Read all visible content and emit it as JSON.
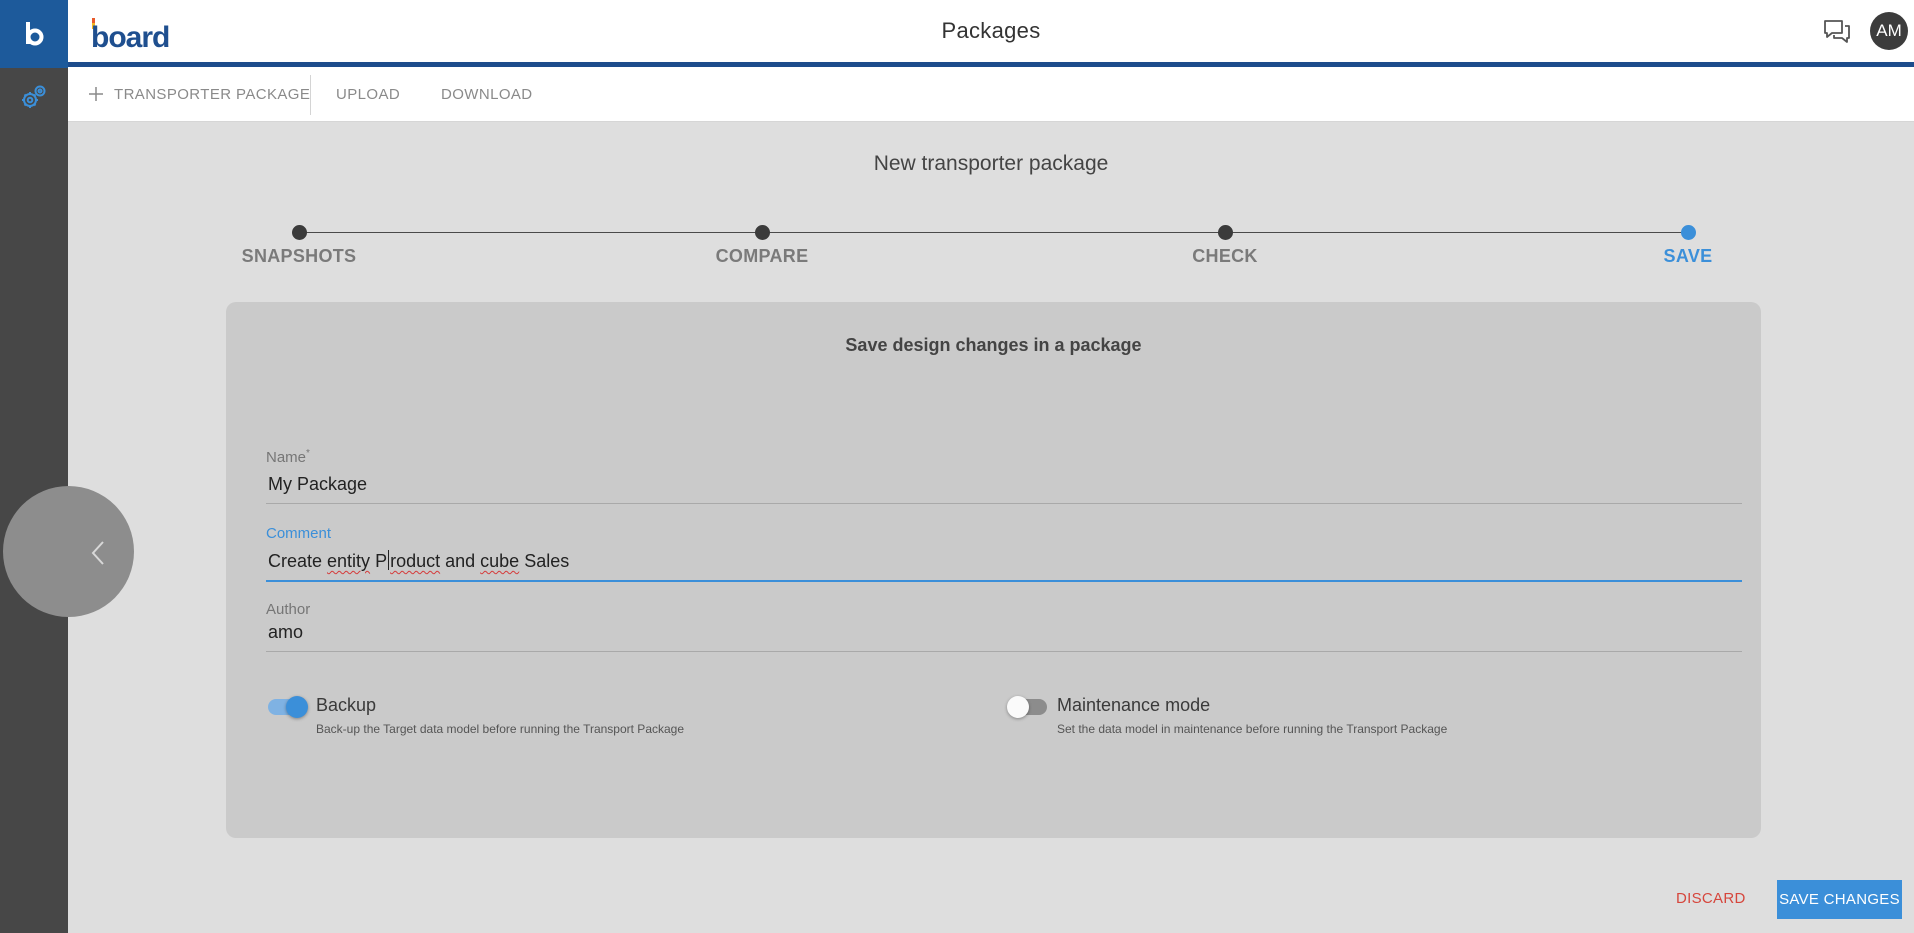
{
  "rail": {
    "logo_letter": "b"
  },
  "header": {
    "brand": "board",
    "title": "Packages",
    "avatar_initials": "AM"
  },
  "toolbar": {
    "transporter_package": "TRANSPORTER PACKAGE",
    "upload": "UPLOAD",
    "download": "DOWNLOAD"
  },
  "wizard": {
    "title": "New transporter package",
    "steps": [
      {
        "label": "SNAPSHOTS",
        "active": false
      },
      {
        "label": "COMPARE",
        "active": false
      },
      {
        "label": "CHECK",
        "active": false
      },
      {
        "label": "SAVE",
        "active": true
      }
    ]
  },
  "form": {
    "title": "Save design changes in a package",
    "name": {
      "label": "Name",
      "required_mark": "*",
      "value": "My Package"
    },
    "comment": {
      "label": "Comment",
      "value_part1": "Create ",
      "value_part2": "entity",
      "value_part3": " P",
      "value_part4": "roduct",
      "value_part5": " and ",
      "value_part6": "cube",
      "value_part7": " Sales"
    },
    "author": {
      "label": "Author",
      "value": "amo"
    },
    "backup": {
      "title": "Backup",
      "description": "Back-up the Target data model before running the Transport Package",
      "enabled": true
    },
    "maintenance": {
      "title": "Maintenance mode",
      "description": "Set the data model in maintenance before running the Transport Package",
      "enabled": false
    }
  },
  "footer": {
    "discard": "DISCARD",
    "save": "SAVE CHANGES"
  },
  "colors": {
    "accent": "#3b8fd9",
    "brand_dark": "#1d4c8c",
    "discard": "#d6463c",
    "rail": "#474747"
  },
  "icons": {
    "rail_logo": "board-b-logo",
    "rail_settings": "gear-icon",
    "chat": "chat-icon",
    "plus": "plus-icon",
    "back": "chevron-left-icon"
  }
}
